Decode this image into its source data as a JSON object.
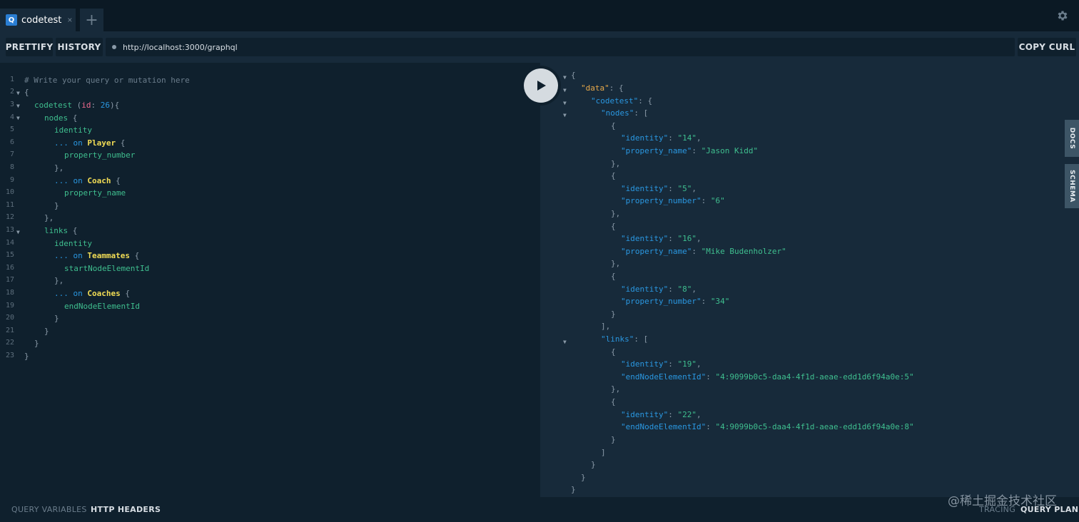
{
  "tabs": [
    {
      "icon": "Q",
      "label": "codetest",
      "close": "×"
    }
  ],
  "tab_add": "+",
  "toolbar": {
    "prettify": "PRETTIFY",
    "history": "HISTORY",
    "url": "http://localhost:3000/graphql",
    "copy_curl": "COPY CURL"
  },
  "editor": {
    "line_numbers": [
      "1",
      "2",
      "3",
      "4",
      "5",
      "6",
      "7",
      "8",
      "9",
      "10",
      "11",
      "12",
      "13",
      "14",
      "15",
      "16",
      "17",
      "18",
      "19",
      "20",
      "21",
      "22",
      "23"
    ]
  },
  "side_tabs": {
    "docs": "DOCS",
    "schema": "SCHEMA"
  },
  "bottom": {
    "query_variables": "QUERY VARIABLES",
    "http_headers": "HTTP HEADERS",
    "tracing": "TRACING",
    "query_plan": "QUERY PLAN"
  },
  "watermark": "@稀土掘金技术社区",
  "colors": {
    "accent": "#2a7ed3",
    "panel": "#172a3a",
    "editor_bg": "#0f202d"
  }
}
